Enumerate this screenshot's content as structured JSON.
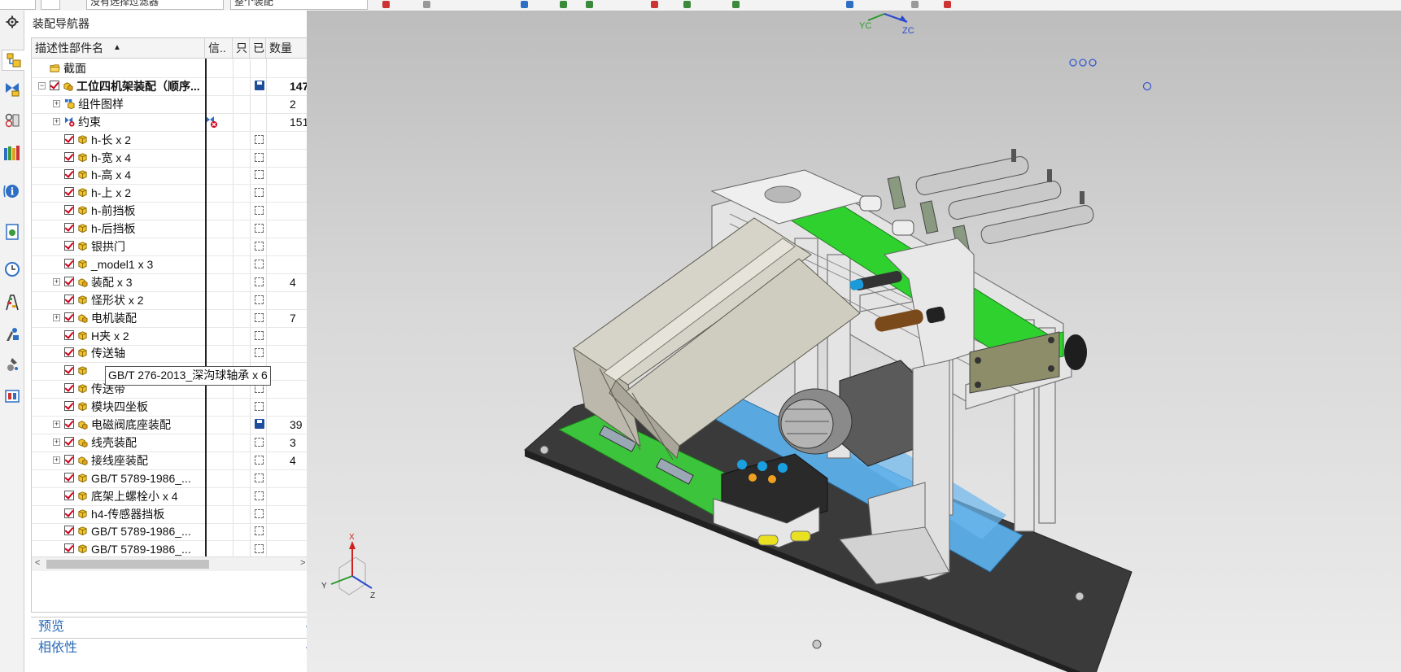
{
  "toolbar": {
    "filter_value": "没有选择过滤器",
    "scope_value": "整个装配"
  },
  "resource_bar": {
    "icons": [
      "settings-icon",
      "assembly-navigator-icon",
      "constraint-navigator-icon",
      "part-navigator-icon",
      "reuse-library-icon",
      "info-icon",
      "web-browser-icon",
      "history-icon",
      "process-studio-icon",
      "roles-icon",
      "system-materials-icon",
      "palette-icon"
    ]
  },
  "navigator": {
    "title": "装配导航器",
    "columns": {
      "name": "描述性部件名",
      "sort_arrow": "▲",
      "info": "信..",
      "readonly": "只",
      "modified": "已",
      "count": "数量"
    },
    "rows": [
      {
        "label": "截面",
        "kind": "folder",
        "level": 0,
        "expand": "",
        "status": "",
        "qty": ""
      },
      {
        "label": "工位四机架装配（顺序...",
        "kind": "assembly",
        "level": 0,
        "expand": "−",
        "check": true,
        "status": "save",
        "qty": "147",
        "bold": true
      },
      {
        "label": "组件图样",
        "kind": "pattern",
        "level": 1,
        "expand": "+",
        "status": "",
        "qty": "2"
      },
      {
        "label": "约束",
        "kind": "constraint",
        "level": 1,
        "expand": "+",
        "status": "",
        "qty": "151"
      },
      {
        "label": "h-长 x 2",
        "kind": "part",
        "level": 1,
        "check": true,
        "status": "box",
        "qty": ""
      },
      {
        "label": "h-宽 x 4",
        "kind": "part",
        "level": 1,
        "check": true,
        "status": "box",
        "qty": ""
      },
      {
        "label": "h-高 x 4",
        "kind": "part",
        "level": 1,
        "check": true,
        "status": "box",
        "qty": ""
      },
      {
        "label": "h-上 x 2",
        "kind": "part",
        "level": 1,
        "check": true,
        "status": "box",
        "qty": ""
      },
      {
        "label": "h-前挡板",
        "kind": "part",
        "level": 1,
        "check": true,
        "status": "box",
        "qty": ""
      },
      {
        "label": "h-后挡板",
        "kind": "part",
        "level": 1,
        "check": true,
        "status": "box",
        "qty": ""
      },
      {
        "label": "银拱门",
        "kind": "part",
        "level": 1,
        "check": true,
        "status": "box",
        "qty": ""
      },
      {
        "label": "_model1 x 3",
        "kind": "part",
        "level": 1,
        "check": true,
        "status": "box",
        "qty": ""
      },
      {
        "label": "装配 x 3",
        "kind": "assembly",
        "level": 1,
        "expand": "+",
        "check": true,
        "status": "box",
        "qty": "4"
      },
      {
        "label": "怪形状 x 2",
        "kind": "part",
        "level": 1,
        "check": true,
        "status": "box",
        "qty": ""
      },
      {
        "label": "电机装配",
        "kind": "assembly",
        "level": 1,
        "expand": "+",
        "check": true,
        "status": "box",
        "qty": "7"
      },
      {
        "label": "H夹 x 2",
        "kind": "part",
        "level": 1,
        "check": true,
        "status": "box",
        "qty": ""
      },
      {
        "label": "传送轴",
        "kind": "part",
        "level": 1,
        "check": true,
        "status": "box",
        "qty": ""
      },
      {
        "label": "",
        "kind": "part",
        "level": 1,
        "check": true,
        "status": "",
        "qty": ""
      },
      {
        "label": "传送带",
        "kind": "part",
        "level": 1,
        "check": true,
        "status": "box",
        "qty": ""
      },
      {
        "label": "模块四坐板",
        "kind": "part",
        "level": 1,
        "check": true,
        "status": "box",
        "qty": ""
      },
      {
        "label": "电磁阀底座装配",
        "kind": "assembly",
        "level": 1,
        "expand": "+",
        "check": true,
        "status": "save",
        "qty": "39"
      },
      {
        "label": "线壳装配",
        "kind": "assembly",
        "level": 1,
        "expand": "+",
        "check": true,
        "status": "box",
        "qty": "3"
      },
      {
        "label": "接线座装配",
        "kind": "assembly",
        "level": 1,
        "expand": "+",
        "check": true,
        "status": "box",
        "qty": "4"
      },
      {
        "label": "GB/T 5789-1986_...",
        "kind": "part",
        "level": 1,
        "check": true,
        "status": "box",
        "qty": ""
      },
      {
        "label": "底架上螺栓小 x 4",
        "kind": "part",
        "level": 1,
        "check": true,
        "status": "box",
        "qty": ""
      },
      {
        "label": "h4-传感器挡板",
        "kind": "part",
        "level": 1,
        "check": true,
        "status": "box",
        "qty": ""
      },
      {
        "label": "GB/T 5789-1986_...",
        "kind": "part",
        "level": 1,
        "check": true,
        "status": "box",
        "qty": ""
      },
      {
        "label": "GB/T 5789-1986_...",
        "kind": "part",
        "level": 1,
        "check": true,
        "status": "box",
        "qty": ""
      }
    ],
    "tooltip": "GB/T 276-2013_深沟球轴承 x 6",
    "sections": [
      {
        "label": "预览"
      },
      {
        "label": "相依性"
      }
    ]
  },
  "viewport": {
    "wcs_labels": {
      "yc": "YC",
      "zc": "ZC"
    },
    "triad_labels": {
      "x": "X",
      "y": "Y",
      "z": "Z"
    },
    "colors": {
      "frame": "#e2e2e2",
      "belt": "#2fd12f",
      "base": "#3a3a3a",
      "blue": "#59a8e0",
      "pcb": "#3cc43c"
    }
  }
}
